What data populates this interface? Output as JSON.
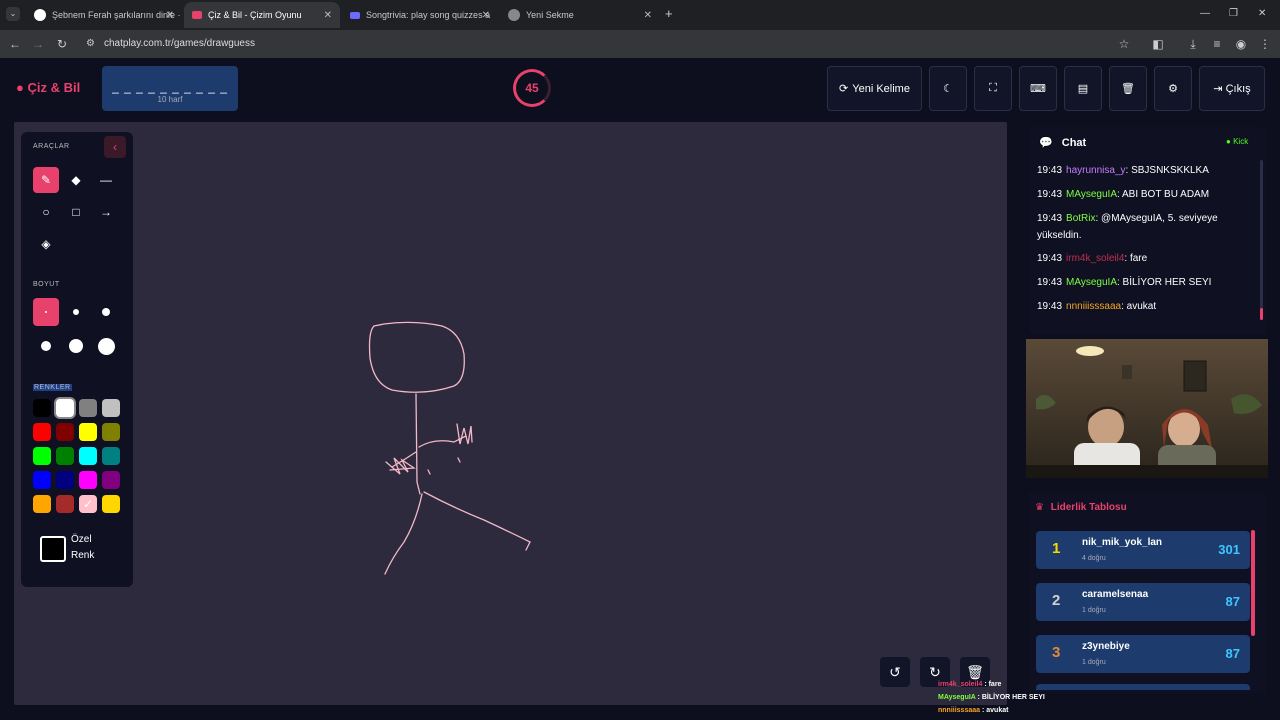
{
  "browser": {
    "tabs": [
      {
        "title": "Şebnem Ferah şarkılarını dinle ·",
        "active": false
      },
      {
        "title": "Çiz & Bil - Çizim Oyunu",
        "active": true
      },
      {
        "title": "Songtrivia: play song quizzes a",
        "active": false
      },
      {
        "title": "Yeni Sekme",
        "active": false
      }
    ],
    "url": "chatplay.com.tr/games/drawguess"
  },
  "header": {
    "logo": "Çiz & Bil",
    "word_mask": "_ _ _ _ _ _ _ _ _ _",
    "letter_count": "10 harf",
    "timer": "45",
    "new_word": "Yeni Kelime",
    "exit": "Çıkış"
  },
  "tools": {
    "section_tools": "ARAÇLAR",
    "section_size": "BOYUT",
    "section_colors": "RENKLER",
    "custom_color_line1": "Özel",
    "custom_color_line2": "Renk",
    "colors": [
      "#000000",
      "#ffffff",
      "#808080",
      "#c0c0c0",
      "#ff0000",
      "#800000",
      "#ffff00",
      "#808000",
      "#00ff00",
      "#008000",
      "#00ffff",
      "#008080",
      "#0000ff",
      "#000080",
      "#ff00ff",
      "#800080",
      "#ffa500",
      "#a52a2a",
      "#ffc0cb",
      "#ffd700"
    ]
  },
  "chat": {
    "title": "Chat",
    "source": "Kick",
    "messages": [
      {
        "time": "19:43",
        "user": "hayrunnisa_y",
        "text": ": SBJSNKSKKLKA",
        "color": "#c77dff"
      },
      {
        "time": "19:43",
        "user": "MAyseguIA",
        "text": ": ABI BOT BU ADAM",
        "color": "#7fff3f"
      },
      {
        "time": "19:43",
        "user": "BotRix",
        "text": ": @MAyseguIA, 5. seviyeye yükseldin.",
        "color": "#7fff3f"
      },
      {
        "time": "19:43",
        "user": "irm4k_soleil4",
        "text": ": fare",
        "color": "#c0304e"
      },
      {
        "time": "19:43",
        "user": "MAyseguIA",
        "text": ": BİLİYOR HER SEYI",
        "color": "#7fff3f"
      },
      {
        "time": "19:43",
        "user": "nnniiisssaaa",
        "text": ": avukat",
        "color": "#f5a623"
      }
    ]
  },
  "leaderboard": {
    "title": "Liderlik Tablosu",
    "rows": [
      {
        "rank": "1",
        "name": "nik_mik_yok_lan",
        "sub": "4 doğru",
        "score": "301",
        "rank_color": "#ffd700"
      },
      {
        "rank": "2",
        "name": "caramelsenaa",
        "sub": "1 doğru",
        "score": "87",
        "rank_color": "#d0d0d0"
      },
      {
        "rank": "3",
        "name": "z3ynebiye",
        "sub": "1 doğru",
        "score": "87",
        "rank_color": "#e08a3a"
      }
    ]
  },
  "overlay_chat": [
    {
      "user": "irm4k_soleil4",
      "text": " : fare",
      "color": "#e8416c"
    },
    {
      "user": "MAyseguIA",
      "text": " : BİLİYOR HER SEYI",
      "color": "#7fff3f"
    },
    {
      "user": "nnniiisssaaa",
      "text": " : avukat",
      "color": "#f5a623"
    }
  ]
}
